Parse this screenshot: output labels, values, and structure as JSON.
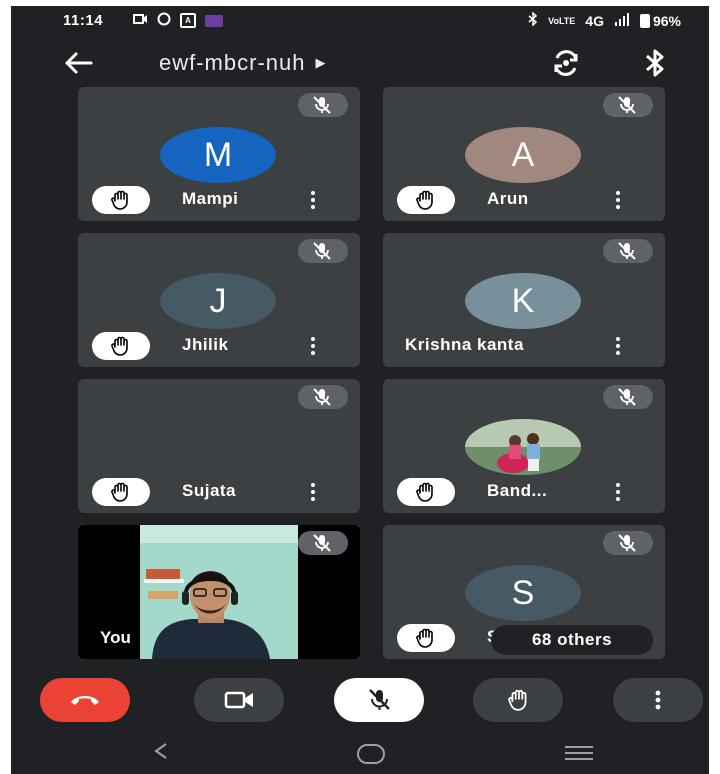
{
  "status_bar": {
    "time": "11:14",
    "network": "4G",
    "battery": "96%",
    "left_icons": [
      "video-camera-icon",
      "whatsapp-icon",
      "a-box-icon",
      "app-notification-icon"
    ],
    "right_icons": [
      "bluetooth-icon",
      "volte-icon",
      "signal-icon",
      "battery-icon"
    ]
  },
  "top_bar": {
    "meeting_code": "ewf-mbcr-nuh",
    "icons": [
      "back-arrow-icon",
      "expand-triangle-icon",
      "switch-camera-icon",
      "bluetooth-audio-icon"
    ]
  },
  "participants": [
    {
      "name": "Mampi",
      "initial": "M",
      "avatar_color": "#1565c0",
      "muted": true,
      "hand_raised": true
    },
    {
      "name": "Arun",
      "initial": "A",
      "avatar_color": "#a1887f",
      "muted": true,
      "hand_raised": true
    },
    {
      "name": "Jhilik",
      "initial": "J",
      "avatar_color": "#455a64",
      "muted": true,
      "hand_raised": true
    },
    {
      "name": "Krishna kanta",
      "initial": "K",
      "avatar_color": "#78909c",
      "muted": true,
      "hand_raised": true
    },
    {
      "name": "Sujata",
      "initial": "",
      "muted": true,
      "hand_raised": true
    },
    {
      "name": "Band...",
      "initial": "",
      "avatar_type": "photo",
      "muted": true,
      "hand_raised": true
    },
    {
      "name": "You",
      "self_video": true,
      "muted": true
    },
    {
      "name": "Sa",
      "initial": "S",
      "avatar_color": "#455a64",
      "muted": true,
      "hand_raised": true
    }
  ],
  "others_count_label": "68 others",
  "controls": [
    {
      "name": "end-call",
      "icon": "phone-hangup-icon",
      "color": "#ea4335"
    },
    {
      "name": "camera",
      "icon": "video-camera-icon",
      "color": "#3c4043"
    },
    {
      "name": "microphone",
      "icon": "mic-off-icon",
      "color": "#ffffff"
    },
    {
      "name": "raise-hand",
      "icon": "hand-icon",
      "color": "#3c4043"
    },
    {
      "name": "more-options",
      "icon": "more-vert-icon",
      "color": "#3c4043"
    }
  ],
  "nav_bar": [
    "nav-back-icon",
    "nav-home-icon",
    "nav-recents-icon"
  ],
  "theme": {
    "background": "#202124",
    "tile": "#3c4043",
    "text": "#ffffff"
  }
}
